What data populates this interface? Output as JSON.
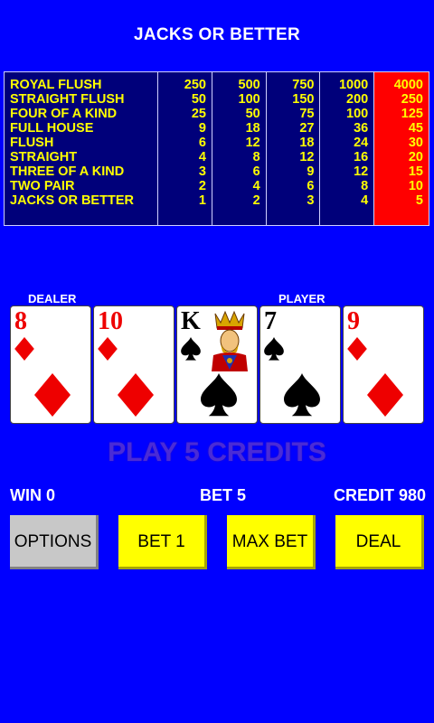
{
  "title": "JACKS OR BETTER",
  "paytable": {
    "hands": [
      "ROYAL FLUSH",
      "STRAIGHT FLUSH",
      "FOUR OF A KIND",
      "FULL HOUSE",
      "FLUSH",
      "STRAIGHT",
      "THREE OF A KIND",
      "TWO PAIR",
      "JACKS OR BETTER"
    ],
    "columns": [
      [
        "250",
        "50",
        "25",
        "9",
        "6",
        "4",
        "3",
        "2",
        "1"
      ],
      [
        "500",
        "100",
        "50",
        "18",
        "12",
        "8",
        "6",
        "4",
        "2"
      ],
      [
        "750",
        "150",
        "75",
        "27",
        "18",
        "12",
        "9",
        "6",
        "3"
      ],
      [
        "1000",
        "200",
        "100",
        "36",
        "24",
        "16",
        "12",
        "8",
        "4"
      ],
      [
        "4000",
        "250",
        "125",
        "45",
        "30",
        "20",
        "15",
        "10",
        "5"
      ]
    ],
    "highlighted_column": 4,
    "text_color": "#ffff00",
    "highlight_color": "#ff0000"
  },
  "labels": {
    "dealer": "DEALER",
    "player": "PLAYER"
  },
  "cards": [
    {
      "rank": "8",
      "suit": "diamonds",
      "color": "red"
    },
    {
      "rank": "10",
      "suit": "diamonds",
      "color": "red"
    },
    {
      "rank": "K",
      "suit": "spades",
      "color": "black",
      "face_icon": "king-portrait-icon"
    },
    {
      "rank": "7",
      "suit": "spades",
      "color": "black"
    },
    {
      "rank": "9",
      "suit": "diamonds",
      "color": "red"
    }
  ],
  "message": "PLAY 5 CREDITS",
  "status": {
    "win": "WIN 0",
    "bet": "BET 5",
    "credit": "CREDIT 980"
  },
  "buttons": {
    "options": "OPTIONS",
    "bet1": "BET 1",
    "max_bet": "MAX BET",
    "deal": "DEAL"
  },
  "colors": {
    "background": "#0000ff",
    "button_yellow": "#ffff00",
    "button_gray": "#c8c8c8"
  }
}
